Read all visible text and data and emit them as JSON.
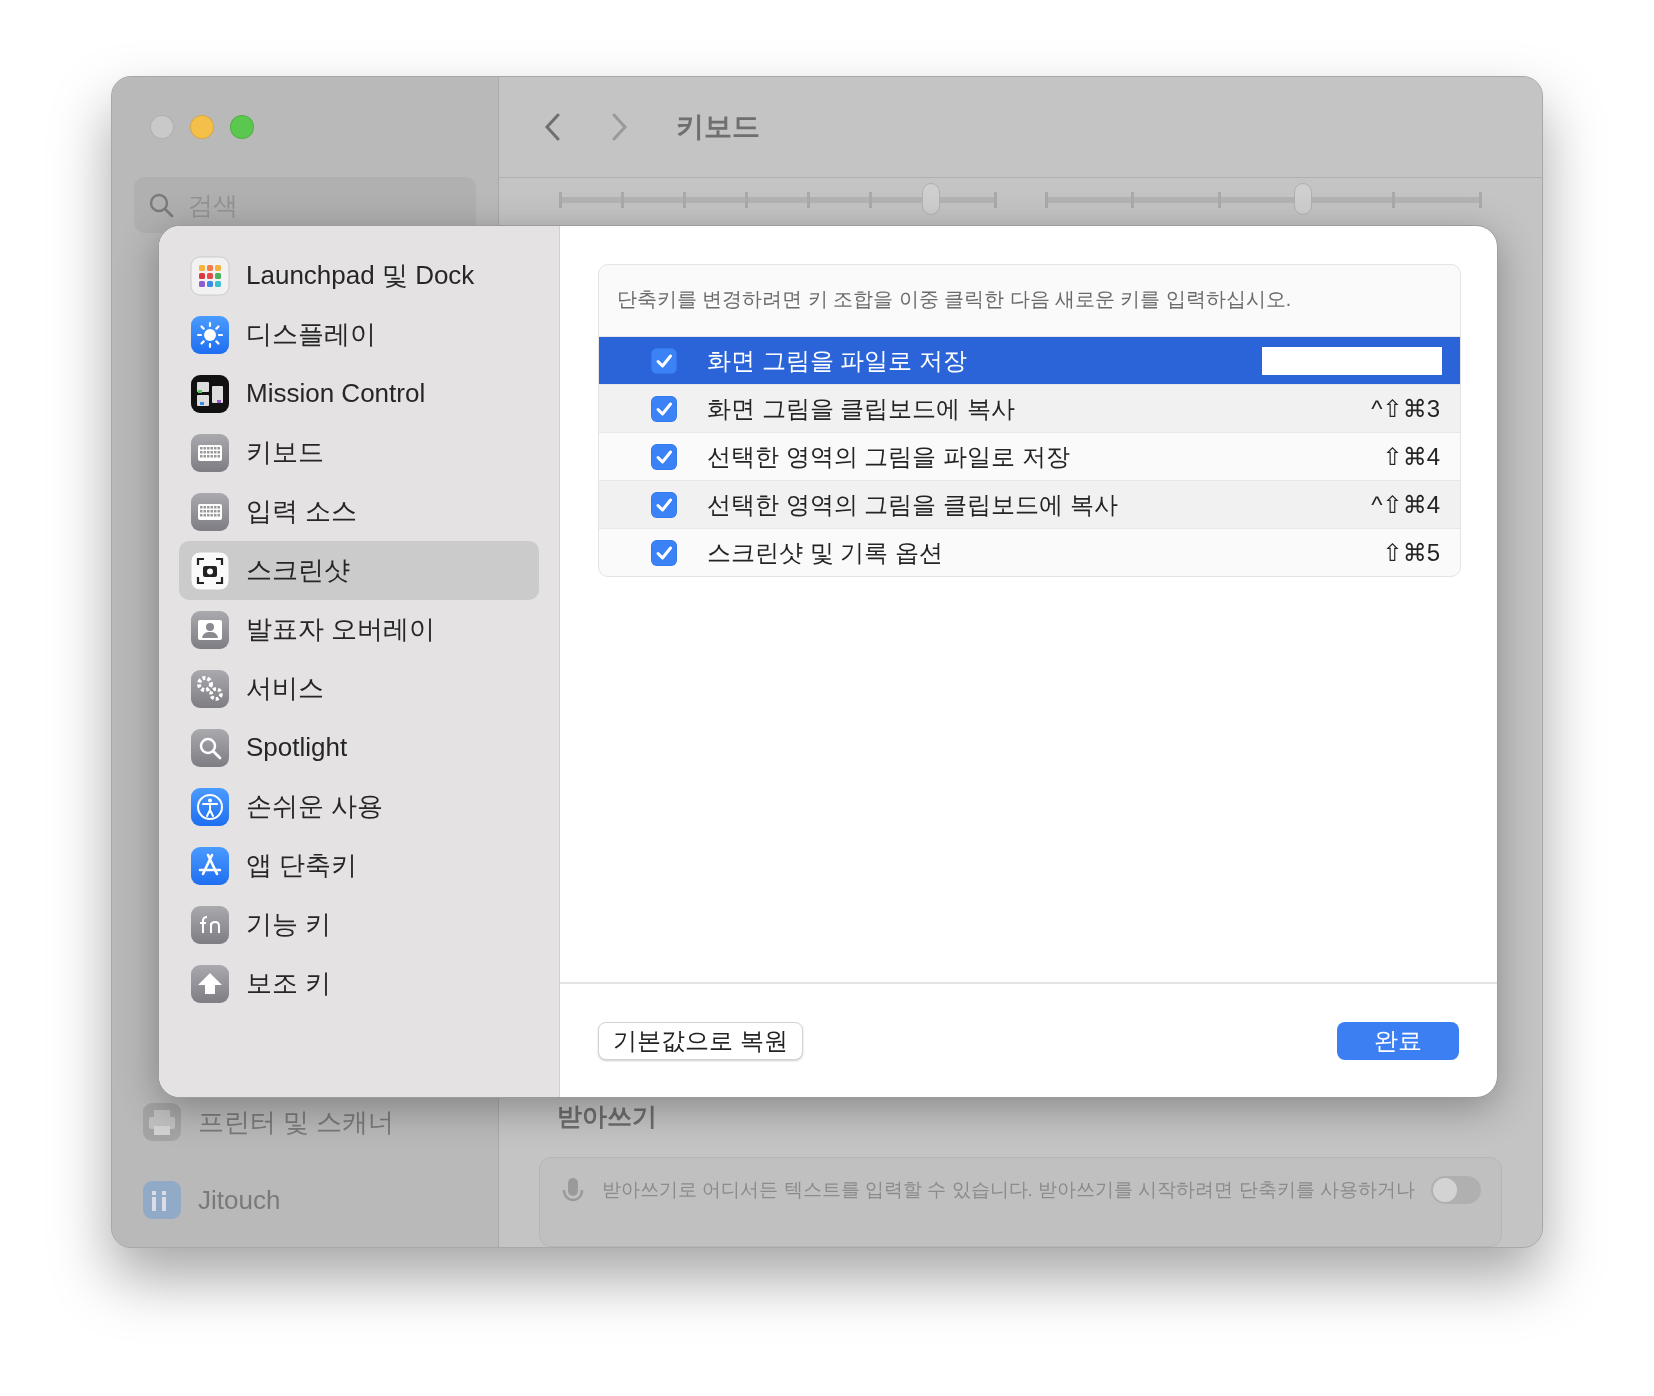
{
  "window": {
    "title": "키보드",
    "search": {
      "placeholder": "검색"
    }
  },
  "background_sidebar": {
    "items": [
      {
        "label": "프린터 및 스캐너"
      },
      {
        "label": "Jitouch"
      }
    ]
  },
  "background_content": {
    "sliders": [
      {
        "level": 0.85
      },
      {
        "level": 0.59
      }
    ],
    "dictation": {
      "heading": "받아쓰기",
      "description": "받아쓰기로 어디서든 텍스트를 입력할 수 있습니다. 받아쓰기를 시작하려면 단축키를 사용하거나",
      "on": false
    }
  },
  "sheet": {
    "sidebar": {
      "items": [
        {
          "label": "Launchpad 및 Dock",
          "selected": false
        },
        {
          "label": "디스플레이",
          "selected": false
        },
        {
          "label": "Mission Control",
          "selected": false
        },
        {
          "label": "키보드",
          "selected": false
        },
        {
          "label": "입력 소스",
          "selected": false
        },
        {
          "label": "스크린샷",
          "selected": true
        },
        {
          "label": "발표자 오버레이",
          "selected": false
        },
        {
          "label": "서비스",
          "selected": false
        },
        {
          "label": "Spotlight",
          "selected": false
        },
        {
          "label": "손쉬운 사용",
          "selected": false
        },
        {
          "label": "앱 단축키",
          "selected": false
        },
        {
          "label": "기능 키",
          "selected": false
        },
        {
          "label": "보조 키",
          "selected": false
        }
      ]
    },
    "instruction": "단축키를 변경하려면 키 조합을 이중 클릭한 다음 새로운 키를 입력하십시오.",
    "shortcuts": [
      {
        "label": "화면 그림을 파일로 저장",
        "checked": true,
        "selected": true
      },
      {
        "label": "화면 그림을 클립보드에 복사",
        "checked": true,
        "selected": false,
        "keys": "^⇧⌘3"
      },
      {
        "label": "선택한 영역의 그림을 파일로 저장",
        "checked": true,
        "selected": false,
        "keys": "⇧⌘4"
      },
      {
        "label": "선택한 영역의 그림을 클립보드에 복사",
        "checked": true,
        "selected": false,
        "keys": "^⇧⌘4"
      },
      {
        "label": "스크린샷 및 기록 옵션",
        "checked": true,
        "selected": false,
        "keys": "⇧⌘5"
      }
    ],
    "buttons": [
      {
        "label": "기본값으로 복원",
        "kind": "secondary"
      },
      {
        "label": "완료",
        "kind": "primary"
      }
    ]
  }
}
